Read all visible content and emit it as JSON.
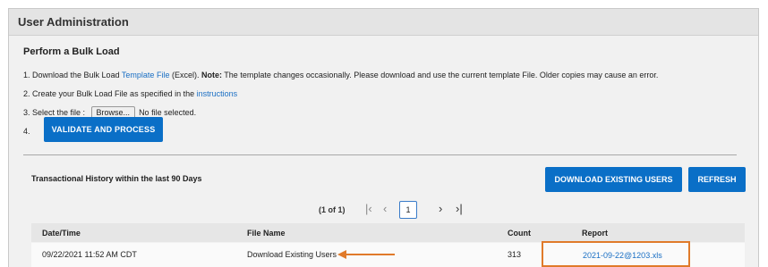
{
  "header": {
    "title": "User Administration"
  },
  "bulk_load": {
    "title": "Perform a Bulk Load",
    "step1": {
      "prefix": "1. Download the Bulk Load ",
      "link": "Template File",
      "after_link": " (Excel).  ",
      "note_label": "Note:",
      "note_text": " The template changes occasionally. Please download and use the current template File. Older copies may cause an error."
    },
    "step2": {
      "prefix": "2. Create your Bulk Load File as specified in the ",
      "link": "instructions"
    },
    "step3": {
      "prefix": "3. Select the file : ",
      "browse_label": "Browse...",
      "file_status": "No file selected."
    },
    "step4": {
      "number": "4.",
      "button_label": "VALIDATE AND PROCESS"
    }
  },
  "history": {
    "title": "Transactional History within the last 90 Days",
    "download_button": "DOWNLOAD EXISTING USERS",
    "refresh_button": "REFRESH",
    "pager": {
      "count_text": "(1 of 1)",
      "current_page": "1"
    },
    "columns": [
      "Date/Time",
      "File Name",
      "Count",
      "Report"
    ],
    "rows": [
      {
        "datetime": "09/22/2021 11:52 AM CDT",
        "file_name": "Download Existing Users",
        "count": "313",
        "report": "2021-09-22@1203.xls"
      }
    ]
  },
  "colors": {
    "primary": "#0a6fc7",
    "link": "#1a6fc4",
    "highlight": "#e07a2a"
  }
}
